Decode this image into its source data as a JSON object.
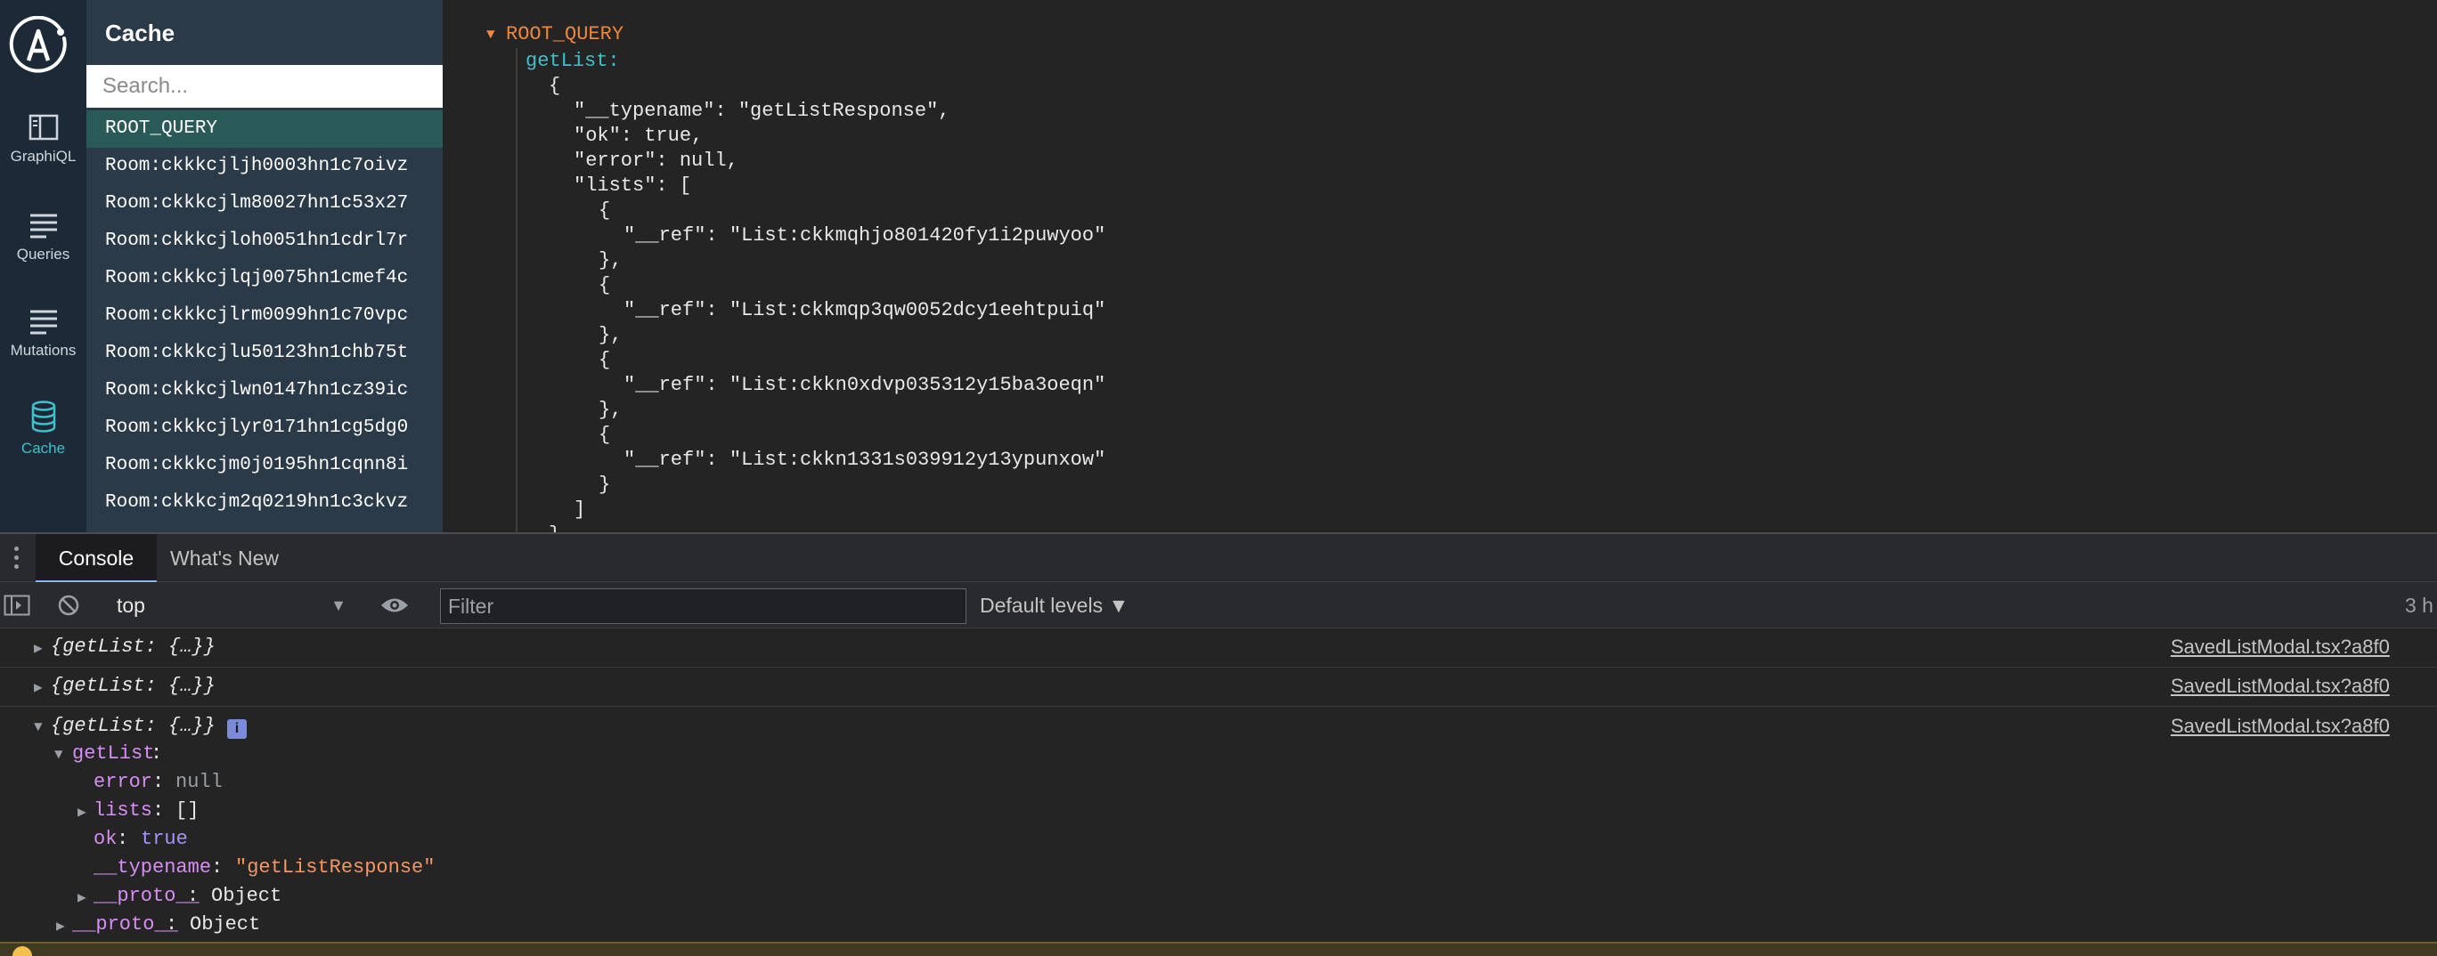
{
  "nav": {
    "items": [
      {
        "label": "GraphiQL",
        "icon": "graphiql-icon"
      },
      {
        "label": "Queries",
        "icon": "queries-icon"
      },
      {
        "label": "Mutations",
        "icon": "mutations-icon"
      },
      {
        "label": "Cache",
        "icon": "database-icon",
        "active": true
      }
    ]
  },
  "cache": {
    "title": "Cache",
    "search_placeholder": "Search...",
    "items": [
      "ROOT_QUERY",
      "Room:ckkkcjljh0003hn1c7oivz",
      "Room:ckkkcjlm80027hn1c53x27",
      "Room:ckkkcjloh0051hn1cdrl7r",
      "Room:ckkkcjlqj0075hn1cmef4c",
      "Room:ckkkcjlrm0099hn1c70vpc",
      "Room:ckkkcjlu50123hn1chb75t",
      "Room:ckkkcjlwn0147hn1cz39ic",
      "Room:ckkkcjlyr0171hn1cg5dg0",
      "Room:ckkkcjm0j0195hn1cqnn8i",
      "Room:ckkkcjm2q0219hn1c3ckvz"
    ]
  },
  "detail": {
    "root_label": "ROOT_QUERY",
    "getlist_key": "getList:",
    "lines": [
      "{",
      "\"__typename\": \"getListResponse\",",
      "\"ok\": true,",
      "\"error\": null,",
      "\"lists\": [",
      "{",
      "\"__ref\": \"List:ckkmqhjo801420fy1i2puwyoo\"",
      "},",
      "{",
      "\"__ref\": \"List:ckkmqp3qw0052dcy1eehtpuiq\"",
      "},",
      "{",
      "\"__ref\": \"List:ckkn0xdvp035312y15ba3oeqn\"",
      "},",
      "{",
      "\"__ref\": \"List:ckkn1331s039912y13ypunxow\"",
      "}",
      "]",
      "}"
    ]
  },
  "console": {
    "tabs": [
      "Console",
      "What's New"
    ],
    "context": "top",
    "filter_placeholder": "Filter",
    "levels": "Default levels ▼",
    "hidden": "3 h",
    "messages": [
      {
        "text": "{getList: {…}}",
        "source": "SavedListModal.tsx?a8f0"
      },
      {
        "text": "{getList: {…}}",
        "source": "SavedListModal.tsx?a8f0"
      },
      {
        "text": "{getList: {…}}",
        "source": "SavedListModal.tsx?a8f0"
      }
    ],
    "info_badge": "i",
    "expanded": {
      "getlist_key": "getList",
      "error_key": "error",
      "error_value": "null",
      "lists_key": "lists",
      "lists_value": "[]",
      "ok_key": "ok",
      "ok_value": "true",
      "typename_key": "__typename",
      "typename_value": "\"getListResponse\"",
      "proto_key": "__proto__",
      "proto_value": "Object",
      "outer_proto_key": "__proto__",
      "outer_proto_value": "Object"
    }
  }
}
